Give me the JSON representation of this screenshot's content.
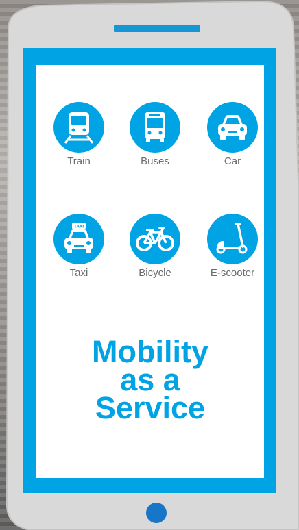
{
  "transport_modes": [
    {
      "label": "Train",
      "icon": "train-icon"
    },
    {
      "label": "Buses",
      "icon": "bus-icon"
    },
    {
      "label": "Car",
      "icon": "car-icon"
    },
    {
      "label": "Taxi",
      "icon": "taxi-icon",
      "badge": "TAXI"
    },
    {
      "label": "Bicycle",
      "icon": "bicycle-icon"
    },
    {
      "label": "E-scooter",
      "icon": "e-scooter-icon"
    }
  ],
  "headline": {
    "line1": "Mobility",
    "line2": "as a",
    "line3": "Service"
  },
  "colors": {
    "accent": "#00a3e3",
    "phone_body": "#d8d8d8",
    "home_button": "#1677c8",
    "label_text": "#6b6b6b"
  }
}
